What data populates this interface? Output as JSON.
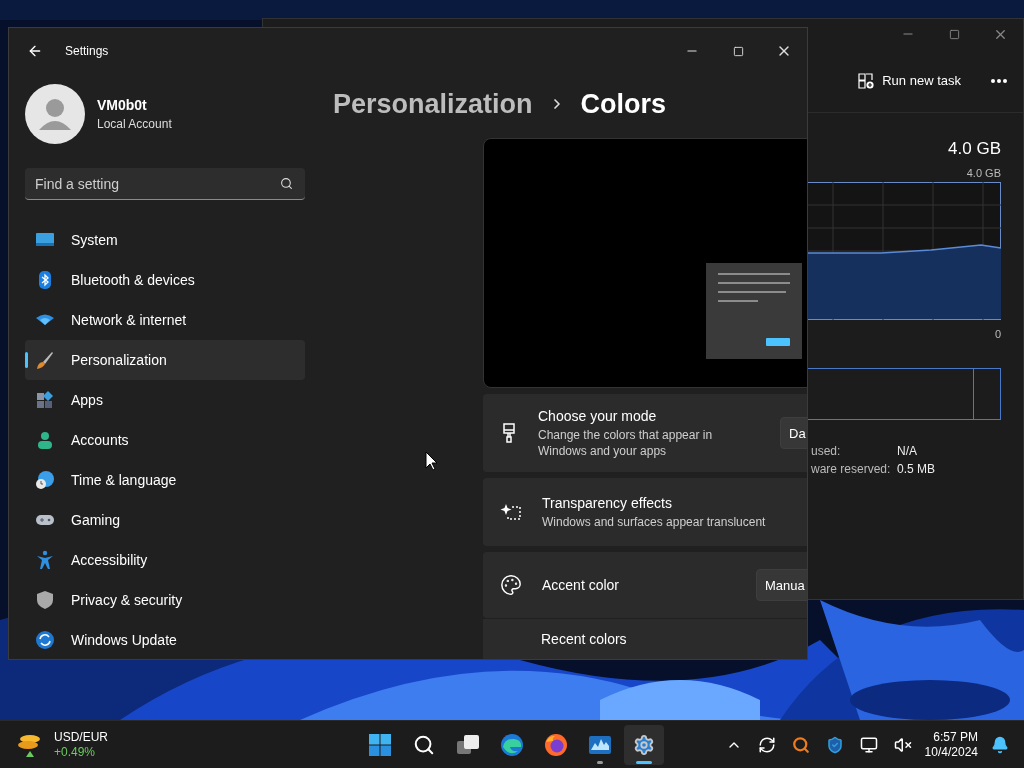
{
  "task_manager": {
    "toolbar": {
      "run_task": "Run new task"
    },
    "memory": {
      "total": "4.0 GB",
      "graph_max": "4.0 GB",
      "graph_min": "0"
    },
    "stats": [
      {
        "label": "used:",
        "value": "N/A"
      },
      {
        "label": "ware reserved:",
        "value": "0.5 MB"
      }
    ]
  },
  "settings": {
    "title": "Settings",
    "user": {
      "name": "VM0b0t",
      "account": "Local Account"
    },
    "search": {
      "placeholder": "Find a setting"
    },
    "nav": [
      {
        "label": "System",
        "selected": false
      },
      {
        "label": "Bluetooth & devices",
        "selected": false
      },
      {
        "label": "Network & internet",
        "selected": false
      },
      {
        "label": "Personalization",
        "selected": true
      },
      {
        "label": "Apps",
        "selected": false
      },
      {
        "label": "Accounts",
        "selected": false
      },
      {
        "label": "Time & language",
        "selected": false
      },
      {
        "label": "Gaming",
        "selected": false
      },
      {
        "label": "Accessibility",
        "selected": false
      },
      {
        "label": "Privacy & security",
        "selected": false
      },
      {
        "label": "Windows Update",
        "selected": false
      }
    ],
    "breadcrumb": {
      "parent": "Personalization",
      "current": "Colors"
    },
    "cards": [
      {
        "kind": "dropdown",
        "title": "Choose your mode",
        "description": "Change the colors that appear in Windows and your apps",
        "value": "Da"
      },
      {
        "kind": "info",
        "title": "Transparency effects",
        "description": "Windows and surfaces appear translucent"
      },
      {
        "kind": "dropdown",
        "title": "Accent color",
        "value": "Manua"
      },
      {
        "kind": "subrow",
        "title": "Recent colors"
      }
    ]
  },
  "taskbar": {
    "widget": {
      "label": "USD/EUR",
      "change": "+0.49%"
    },
    "apps": [
      {
        "selected": false,
        "running": false
      },
      {
        "selected": false,
        "running": false
      },
      {
        "selected": false,
        "running": false
      },
      {
        "selected": false,
        "running": false
      },
      {
        "selected": false,
        "running": false
      },
      {
        "selected": false,
        "running": true
      },
      {
        "selected": true,
        "running": true
      }
    ],
    "clock": {
      "time": "6:57 PM",
      "date": "10/4/2024"
    }
  }
}
